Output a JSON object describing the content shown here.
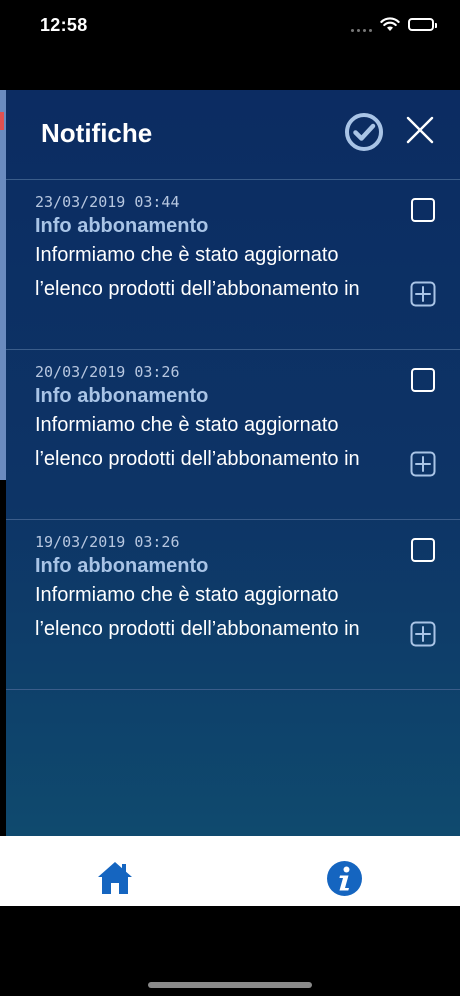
{
  "status_bar": {
    "time": "12:58"
  },
  "header": {
    "title": "Notifiche",
    "mark_all_icon": "check-circle-icon",
    "close_icon": "close-icon"
  },
  "notifications": [
    {
      "date": "23/03/2019 03:44",
      "title": "Info abbonamento",
      "line1": "Informiamo che è stato aggiornato",
      "line2": "l’elenco prodotti dell’abbonamento in"
    },
    {
      "date": "20/03/2019 03:26",
      "title": "Info abbonamento",
      "line1": "Informiamo che è stato aggiornato",
      "line2": "l’elenco prodotti dell’abbonamento in"
    },
    {
      "date": "19/03/2019 03:26",
      "title": "Info abbonamento",
      "line1": "Informiamo che è stato aggiornato",
      "line2": "l’elenco prodotti dell’abbonamento in"
    }
  ],
  "tab_bar": {
    "home_icon": "home-icon",
    "info_icon": "info-icon"
  },
  "colors": {
    "panel": "#0c2c62",
    "accent": "#1565c0",
    "title_blue": "#a9c4e6"
  }
}
